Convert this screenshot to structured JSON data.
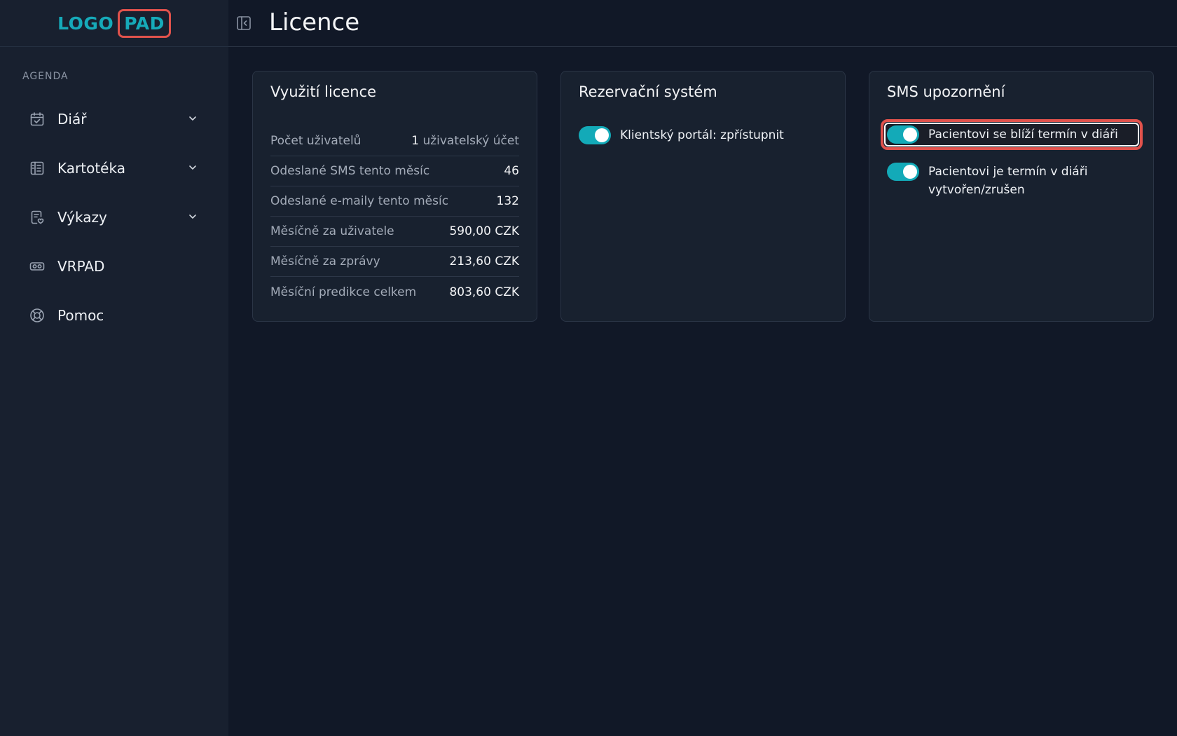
{
  "logo": {
    "left": "LOGO",
    "right": "PAD"
  },
  "sidebar": {
    "section_label": "AGENDA",
    "items": [
      {
        "label": "Diář",
        "icon": "calendar-check-icon",
        "has_chevron": true
      },
      {
        "label": "Kartotéka",
        "icon": "card-index-icon",
        "has_chevron": true
      },
      {
        "label": "Výkazy",
        "icon": "report-icon",
        "has_chevron": true
      },
      {
        "label": "VRPAD",
        "icon": "vr-headset-icon",
        "has_chevron": false
      },
      {
        "label": "Pomoc",
        "icon": "lifebuoy-icon",
        "has_chevron": false
      }
    ]
  },
  "header": {
    "title": "Licence",
    "collapse_icon": "sidebar-collapse-icon"
  },
  "cards": {
    "licence": {
      "title": "Využití licence",
      "rows": [
        {
          "key": "Počet uživatelů",
          "value_num": "1",
          "value_unit": "uživatelský účet"
        },
        {
          "key": "Odeslané SMS tento měsíc",
          "value": "46"
        },
        {
          "key": "Odeslané e-maily tento měsíc",
          "value": "132"
        },
        {
          "key": "Měsíčně za uživatele",
          "value": "590,00 CZK"
        },
        {
          "key": "Měsíčně za zprávy",
          "value": "213,60 CZK"
        },
        {
          "key": "Měsíční predikce celkem",
          "value": "803,60 CZK"
        }
      ]
    },
    "reservation": {
      "title": "Rezervační systém",
      "toggles": [
        {
          "label": "Klientský portál: zpřístupnit",
          "on": true
        }
      ]
    },
    "sms": {
      "title": "SMS upozornění",
      "toggles": [
        {
          "label": "Pacientovi se blíží termín v diáři",
          "on": true,
          "highlighted": true
        },
        {
          "label_line1": "Pacientovi je termín v diáři",
          "label_line2": "vytvořen/zrušen",
          "on": true
        }
      ]
    }
  },
  "colors": {
    "accent": "#13aab8",
    "highlight": "#e0524c",
    "background": "#111827",
    "sidebar": "#18202f"
  }
}
